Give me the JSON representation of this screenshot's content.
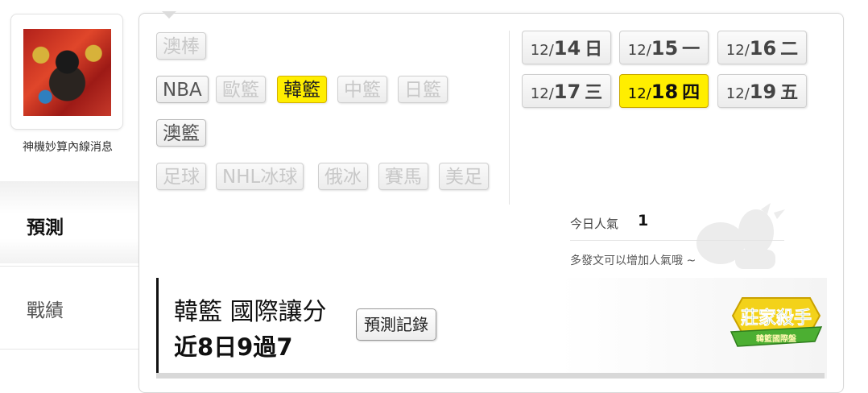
{
  "profile": {
    "name": "神機妙算內線消息"
  },
  "nav": {
    "predict": "預測",
    "record": "戰績"
  },
  "leagues": [
    {
      "label": "澳棒",
      "state": "disabled"
    },
    {
      "label": "NBA",
      "state": "active"
    },
    {
      "label": "歐籃",
      "state": "disabled"
    },
    {
      "label": "韓籃",
      "state": "selected"
    },
    {
      "label": "中籃",
      "state": "disabled"
    },
    {
      "label": "日籃",
      "state": "disabled"
    },
    {
      "label": "澳籃",
      "state": "active"
    },
    {
      "label": "足球",
      "state": "disabled"
    },
    {
      "label": "NHL冰球",
      "state": "disabled"
    },
    {
      "label": "俄冰",
      "state": "disabled"
    },
    {
      "label": "賽馬",
      "state": "disabled"
    },
    {
      "label": "美足",
      "state": "disabled"
    }
  ],
  "dates": [
    {
      "month": "12/",
      "day": "14",
      "weekday": "日"
    },
    {
      "month": "12/",
      "day": "15",
      "weekday": "一"
    },
    {
      "month": "12/",
      "day": "16",
      "weekday": "二"
    },
    {
      "month": "12/",
      "day": "17",
      "weekday": "三"
    },
    {
      "month": "12/",
      "day": "18",
      "weekday": "四",
      "selected": true
    },
    {
      "month": "12/",
      "day": "19",
      "weekday": "五"
    }
  ],
  "popularity": {
    "label": "今日人氣",
    "value": "1",
    "hint": "多發文可以增加人氣哦 ~"
  },
  "headline": {
    "title": "韓籃 國際讓分",
    "streak": "近8日9過7",
    "record_button": "預測記錄"
  },
  "badge": {
    "main": "莊家殺手",
    "sub": "韓籃國際盤"
  },
  "colors": {
    "highlight": "#ffee00",
    "badge_green": "#4caf32",
    "badge_yellow": "#f3d21a"
  }
}
